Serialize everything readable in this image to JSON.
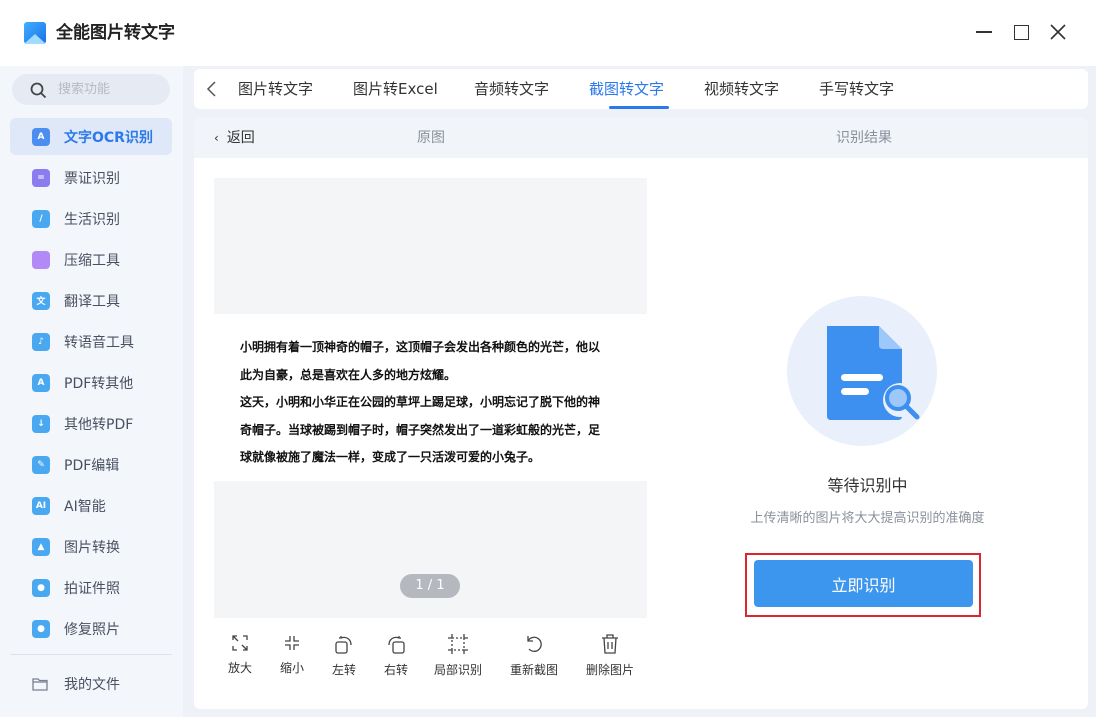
{
  "app": {
    "title": "全能图片转文字"
  },
  "window_controls": {
    "minimize_icon": "minimize-icon",
    "maximize_icon": "maximize-icon",
    "close_icon": "close-icon"
  },
  "sidebar": {
    "search_placeholder": "搜索功能",
    "items": [
      {
        "label": "文字OCR识别",
        "icon": "ocr-icon",
        "color": "#4b8ef0",
        "glyph": "A",
        "active": true
      },
      {
        "label": "票证识别",
        "icon": "ticket-icon",
        "color": "#8b7cf0",
        "glyph": "=",
        "active": false
      },
      {
        "label": "生活识别",
        "icon": "life-icon",
        "color": "#4aa8f0",
        "glyph": "/",
        "active": false
      },
      {
        "label": "压缩工具",
        "icon": "compress-icon",
        "color": "#b28af5",
        "glyph": "",
        "active": false
      },
      {
        "label": "翻译工具",
        "icon": "translate-icon",
        "color": "#4aa8f0",
        "glyph": "文",
        "active": false
      },
      {
        "label": "转语音工具",
        "icon": "voice-icon",
        "color": "#4aa8f0",
        "glyph": "♪",
        "active": false
      },
      {
        "label": "PDF转其他",
        "icon": "pdf-convert-icon",
        "color": "#4aa8f0",
        "glyph": "A",
        "active": false
      },
      {
        "label": "其他转PDF",
        "icon": "to-pdf-icon",
        "color": "#4aa8f0",
        "glyph": "↓",
        "active": false
      },
      {
        "label": "PDF编辑",
        "icon": "pdf-edit-icon",
        "color": "#4aa8f0",
        "glyph": "✎",
        "active": false
      },
      {
        "label": "AI智能",
        "icon": "ai-icon",
        "color": "#4aa8f0",
        "glyph": "AI",
        "active": false
      },
      {
        "label": "图片转换",
        "icon": "image-convert-icon",
        "color": "#4aa8f0",
        "glyph": "▲",
        "active": false
      },
      {
        "label": "拍证件照",
        "icon": "id-photo-icon",
        "color": "#4aa8f0",
        "glyph": "●",
        "active": false
      },
      {
        "label": "修复照片",
        "icon": "repair-photo-icon",
        "color": "#4aa8f0",
        "glyph": "●",
        "active": false
      }
    ],
    "my_files": "我的文件"
  },
  "tabs": [
    {
      "label": "图片转文字",
      "active": false
    },
    {
      "label": "图片转Excel",
      "active": false
    },
    {
      "label": "音频转文字",
      "active": false
    },
    {
      "label": "截图转文字",
      "active": true
    },
    {
      "label": "视频转文字",
      "active": false
    },
    {
      "label": "手写转文字",
      "active": false
    }
  ],
  "panel": {
    "back_label": "返回",
    "original_label": "原图",
    "result_label": "识别结果"
  },
  "preview": {
    "lines": [
      "小明拥有着一顶神奇的帽子，这顶帽子会发出各种颜色的光芒，他以",
      "此为自豪，总是喜欢在人多的地方炫耀。",
      "这天，小明和小华正在公园的草坪上踢足球，小明忘记了脱下他的神",
      "奇帽子。当球被踢到帽子时，帽子突然发出了一道彩虹般的光芒，足",
      "球就像被施了魔法一样，变成了一只活泼可爱的小兔子。"
    ],
    "page_indicator": "1 / 1"
  },
  "tools": [
    {
      "label": "放大",
      "icon": "zoom-in-icon"
    },
    {
      "label": "缩小",
      "icon": "zoom-out-icon"
    },
    {
      "label": "左转",
      "icon": "rotate-left-icon"
    },
    {
      "label": "右转",
      "icon": "rotate-right-icon"
    },
    {
      "label": "局部识别",
      "icon": "crop-icon"
    },
    {
      "label": "重新截图",
      "icon": "recapture-icon"
    },
    {
      "label": "删除图片",
      "icon": "trash-icon"
    }
  ],
  "result": {
    "status": "等待识别中",
    "hint": "上传清晰的图片将大大提高识别的准确度",
    "button_label": "立即识别"
  },
  "colors": {
    "accent": "#2b79ea",
    "button": "#3d96ee",
    "highlight_frame": "#d9272e"
  }
}
